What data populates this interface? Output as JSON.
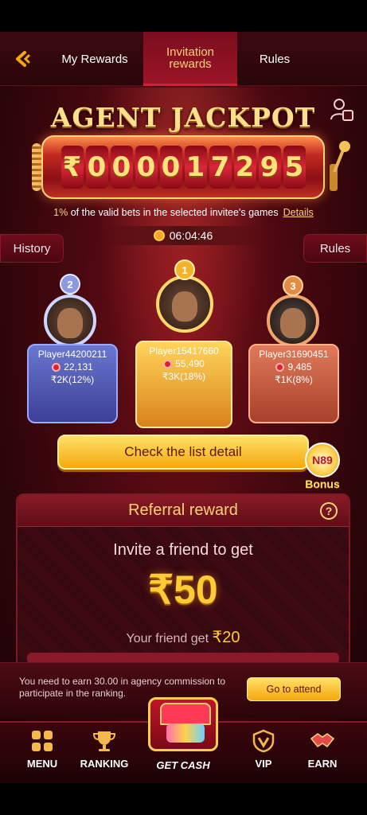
{
  "header": {
    "tabs": [
      {
        "label": "My Rewards"
      },
      {
        "label_line1": "Invitation",
        "label_line2": "rewards"
      },
      {
        "label": "Rules"
      }
    ]
  },
  "jackpot": {
    "title": "AGENT JACKPOT",
    "currency": "₹",
    "digits": [
      "0",
      "0",
      "0",
      "0",
      "1",
      "7",
      "2",
      "9",
      "5"
    ],
    "bets_pct": "1%",
    "bets_text": " of the valid bets in the selected invitee's games",
    "details_link": "Details",
    "timer": "06:04:46"
  },
  "side_buttons": {
    "history": "History",
    "rules": "Rules"
  },
  "podium": {
    "second": {
      "rank": "2",
      "name": "Player44200211",
      "bets": "22,131",
      "reward": "₹2K(12%)"
    },
    "first": {
      "rank": "1",
      "name": "Player15417660",
      "bets": "55,490",
      "reward": "₹3K(18%)"
    },
    "third": {
      "rank": "3",
      "name": "Player31690451",
      "bets": "9,485",
      "reward": "₹1K(8%)"
    }
  },
  "cta": {
    "label": "Check the list detail"
  },
  "bonus": {
    "badge": "N89",
    "label": "Bonus"
  },
  "referral": {
    "title": "Referral reward",
    "help": "?",
    "invite_text": "Invite a friend to get",
    "amount": "₹50",
    "friend_prefix": "Your friend get ",
    "friend_value": "₹20"
  },
  "notice": {
    "text": "You need to earn 30.00 in agency commission to participate in the ranking.",
    "button": "Go to attend"
  },
  "bottom_nav": {
    "menu": "MENU",
    "ranking": "RANKING",
    "get_cash": "GET CASH",
    "vip": "VIP",
    "earn": "EARN"
  },
  "colors": {
    "accent_gold": "#ffd27a",
    "cta_yellow": "#f5a80e",
    "bg_red": "#4a0810"
  }
}
